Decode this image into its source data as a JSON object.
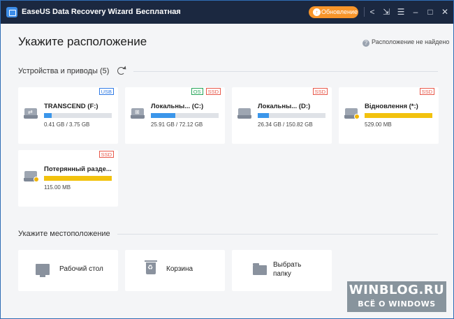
{
  "titlebar": {
    "app_name": "EaseUS Data Recovery Wizard",
    "edition": "Бесплатная",
    "update_label": "Обновление",
    "icons": [
      "share-icon",
      "login-icon",
      "menu-icon",
      "minimize-icon",
      "maximize-icon",
      "close-icon"
    ]
  },
  "page": {
    "title": "Укажите расположение",
    "help_link": "Расположение не найдено"
  },
  "devices": {
    "heading": "Устройства и приводы (5)",
    "items": [
      {
        "name": "TRANSCEND (F:)",
        "size": "0.41 GB / 3.75 GB",
        "used_fraction": 0.11,
        "badges": [
          "USB"
        ],
        "icon": "usb-drive-icon",
        "bar_color": "#3b96ea"
      },
      {
        "name": "Локальны... (C:)",
        "size": "25.91 GB / 72.12 GB",
        "used_fraction": 0.36,
        "badges": [
          "OS",
          "SSD"
        ],
        "icon": "windows-drive-icon",
        "bar_color": "#3b96ea"
      },
      {
        "name": "Локальны... (D:)",
        "size": "26.34 GB / 150.82 GB",
        "used_fraction": 0.17,
        "badges": [
          "SSD"
        ],
        "icon": "drive-icon",
        "bar_color": "#3b96ea"
      },
      {
        "name": "Відновлення (*:)",
        "size": "529.00 MB",
        "used_fraction": 1.0,
        "badges": [
          "SSD"
        ],
        "icon": "lost-drive-icon",
        "bar_color": "#f2c20e"
      },
      {
        "name": "Потерянный разде...",
        "size": "115.00 MB",
        "used_fraction": 1.0,
        "badges": [
          "SSD"
        ],
        "icon": "lost-drive-icon",
        "bar_color": "#f2c20e"
      }
    ]
  },
  "locations": {
    "heading": "Укажите местоположение",
    "items": [
      {
        "label": "Рабочий стол",
        "icon": "desktop-icon"
      },
      {
        "label": "Корзина",
        "icon": "recycle-bin-icon"
      },
      {
        "label_line1": "Выбрать",
        "label_line2": "папку",
        "icon": "folder-icon"
      }
    ]
  },
  "watermark": {
    "title": "WINBLOG.RU",
    "subtitle": "ВСЁ О WINDOWS"
  }
}
